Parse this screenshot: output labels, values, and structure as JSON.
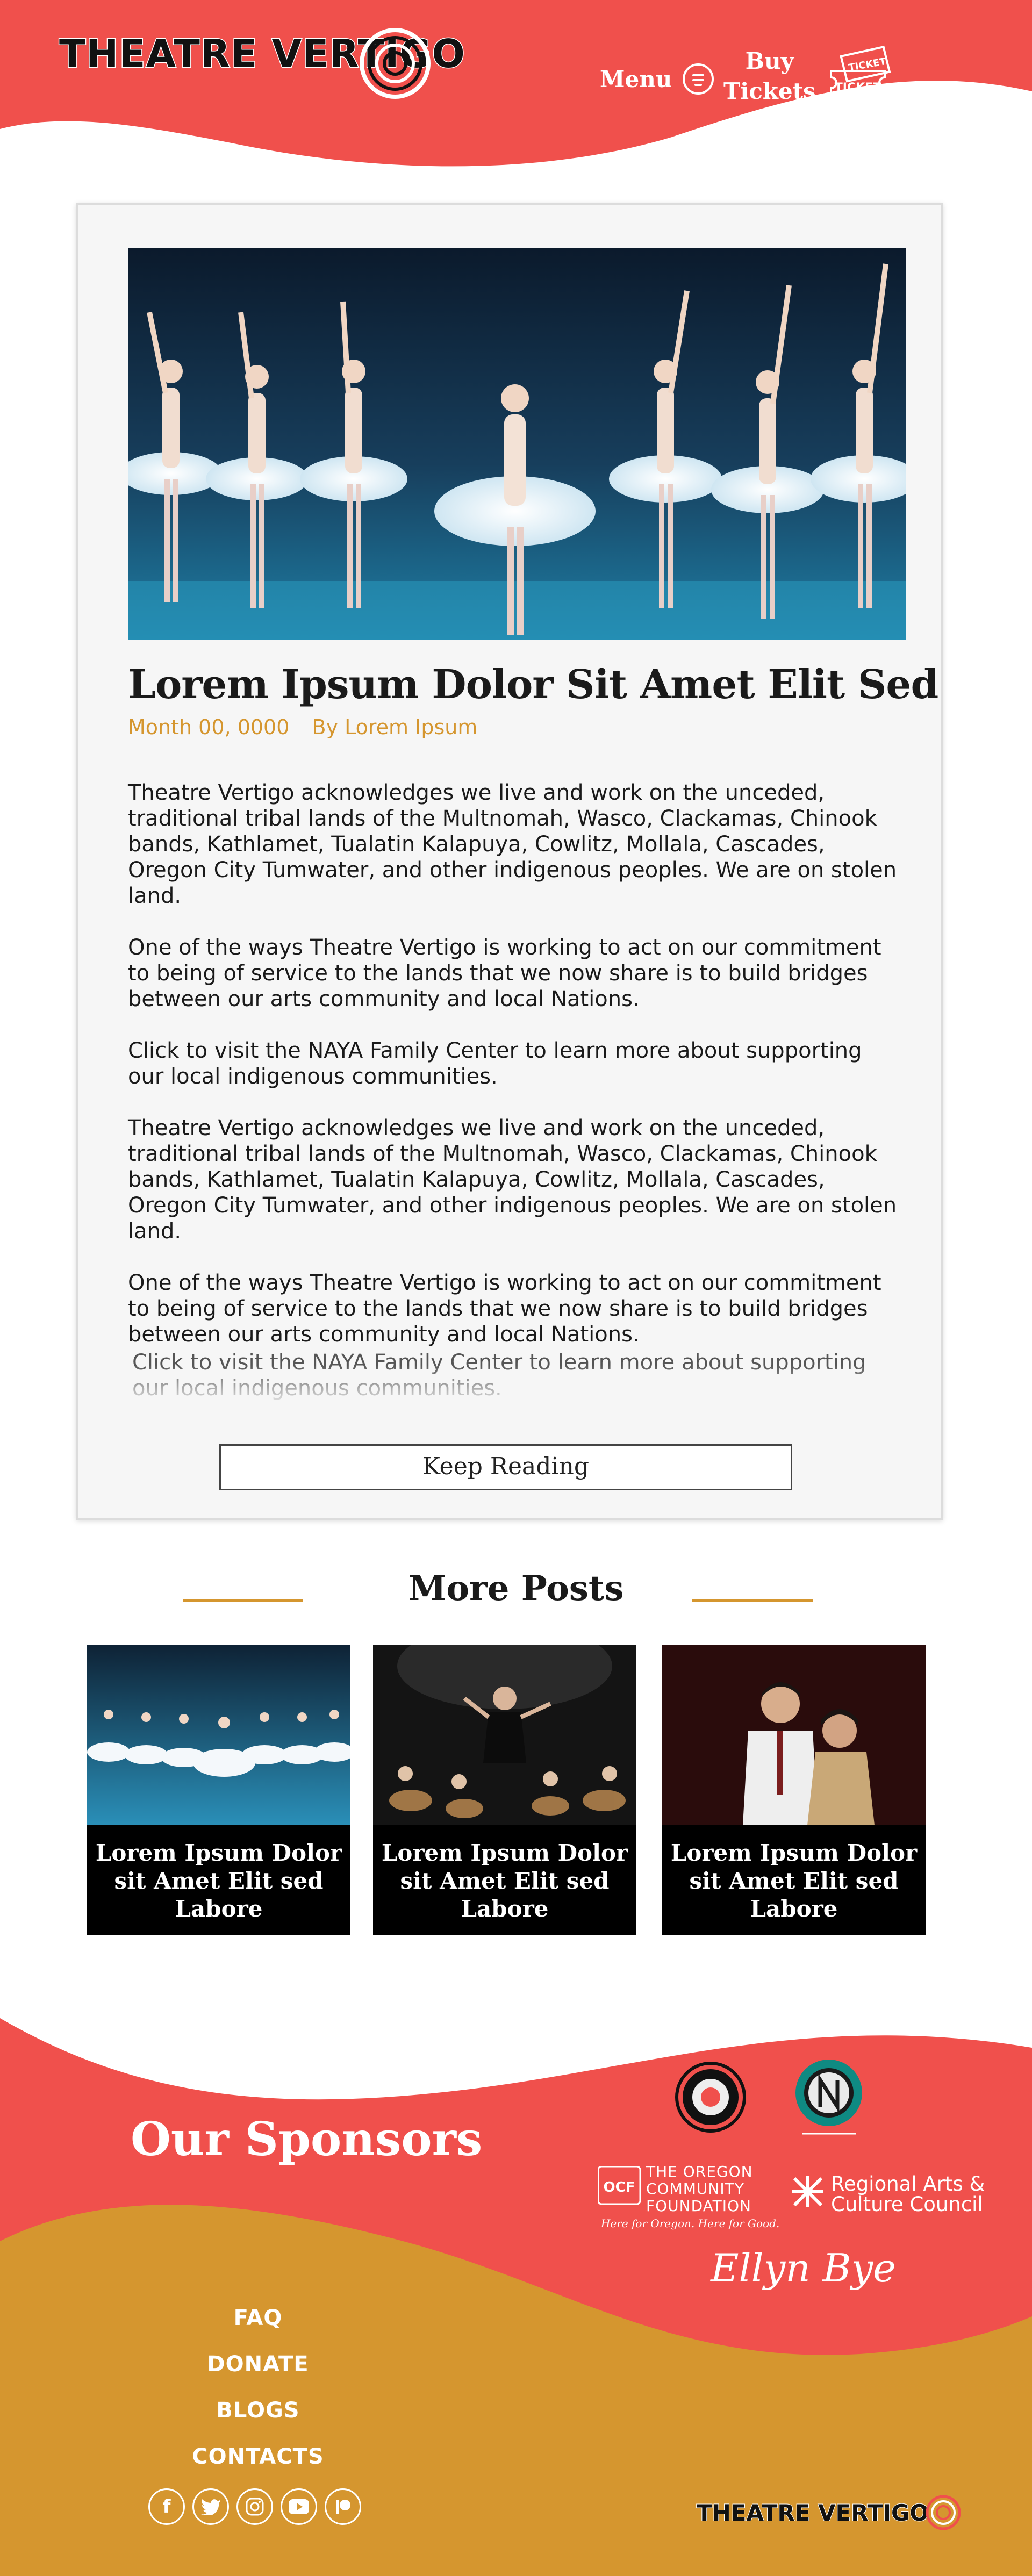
{
  "header": {
    "logo_text": "THEATRE VERTIGO",
    "menu_label": "Menu",
    "tickets_label_line1": "Buy",
    "tickets_label_line2": "Tickets",
    "ticket_icon_text_1": "TICKET",
    "ticket_icon_text_2": "TICKET",
    "colors": {
      "primary": "#f0504c",
      "accent": "#d5962f"
    }
  },
  "article": {
    "title": "Lorem Ipsum Dolor Sit Amet Elit Sed",
    "date": "Month 00, 0000",
    "author": "By Lorem Ipsum",
    "paragraphs": [
      "Theatre Vertigo acknowledges we live and work on the unceded, traditional tribal lands of the Multnomah, Wasco, Clackamas, Chinook bands, Kathlamet, Tualatin Kalapuya, Cowlitz, Mollala, Cascades, Oregon City Tumwater, and other indigenous peoples.   We are on stolen land.",
      "One of the ways Theatre Vertigo is working to act on our commitment to being of service to the lands that we now share is to build bridges between our arts community and local Nations.",
      "Click to visit the NAYA Family Center to learn more about supporting our local indigenous communities.",
      "Theatre Vertigo acknowledges we live and work on the unceded, traditional tribal lands of the Multnomah, Wasco, Clackamas, Chinook bands, Kathlamet, Tualatin Kalapuya, Cowlitz, Mollala, Cascades, Oregon City Tumwater, and other indigenous peoples.   We are on stolen land.",
      "One of the ways Theatre Vertigo is working to act on our commitment to being of service to the lands that we now share is to build bridges between our arts community and local Nations."
    ],
    "faded_paragraph": "Click to visit the NAYA Family Center to learn more about supporting our local indigenous communities.",
    "keep_reading_label": "Keep Reading"
  },
  "more_posts": {
    "heading": "More Posts",
    "posts": [
      {
        "title": "Lorem Ipsum Dolor sit Amet Elit sed Labore"
      },
      {
        "title": "Lorem Ipsum Dolor sit Amet Elit sed Labore"
      },
      {
        "title": "Lorem Ipsum Dolor sit Amet Elit sed Labore"
      }
    ]
  },
  "footer": {
    "sponsors_heading": "Our Sponsors",
    "sponsor_ocf_abbr": "OCF",
    "sponsor_ocf_line1": "THE OREGON",
    "sponsor_ocf_line2": "COMMUNITY",
    "sponsor_ocf_line3": "FOUNDATION",
    "sponsor_ocf_tagline": "Here for Oregon. Here for Good.",
    "sponsor_racc_line1": "Regional Arts &",
    "sponsor_racc_line2": "Culture Council",
    "sponsor_ellyn": "Ellyn Bye",
    "nav": [
      "FAQ",
      "DONATE",
      "BLOGS",
      "CONTACTS"
    ],
    "socials": [
      "facebook-icon",
      "twitter-icon",
      "instagram-icon",
      "youtube-icon",
      "patreon-icon"
    ],
    "logo_text": "THEATRE VERTIGO",
    "colors": {
      "red": "#f0504c",
      "gold": "#d5962f"
    }
  }
}
